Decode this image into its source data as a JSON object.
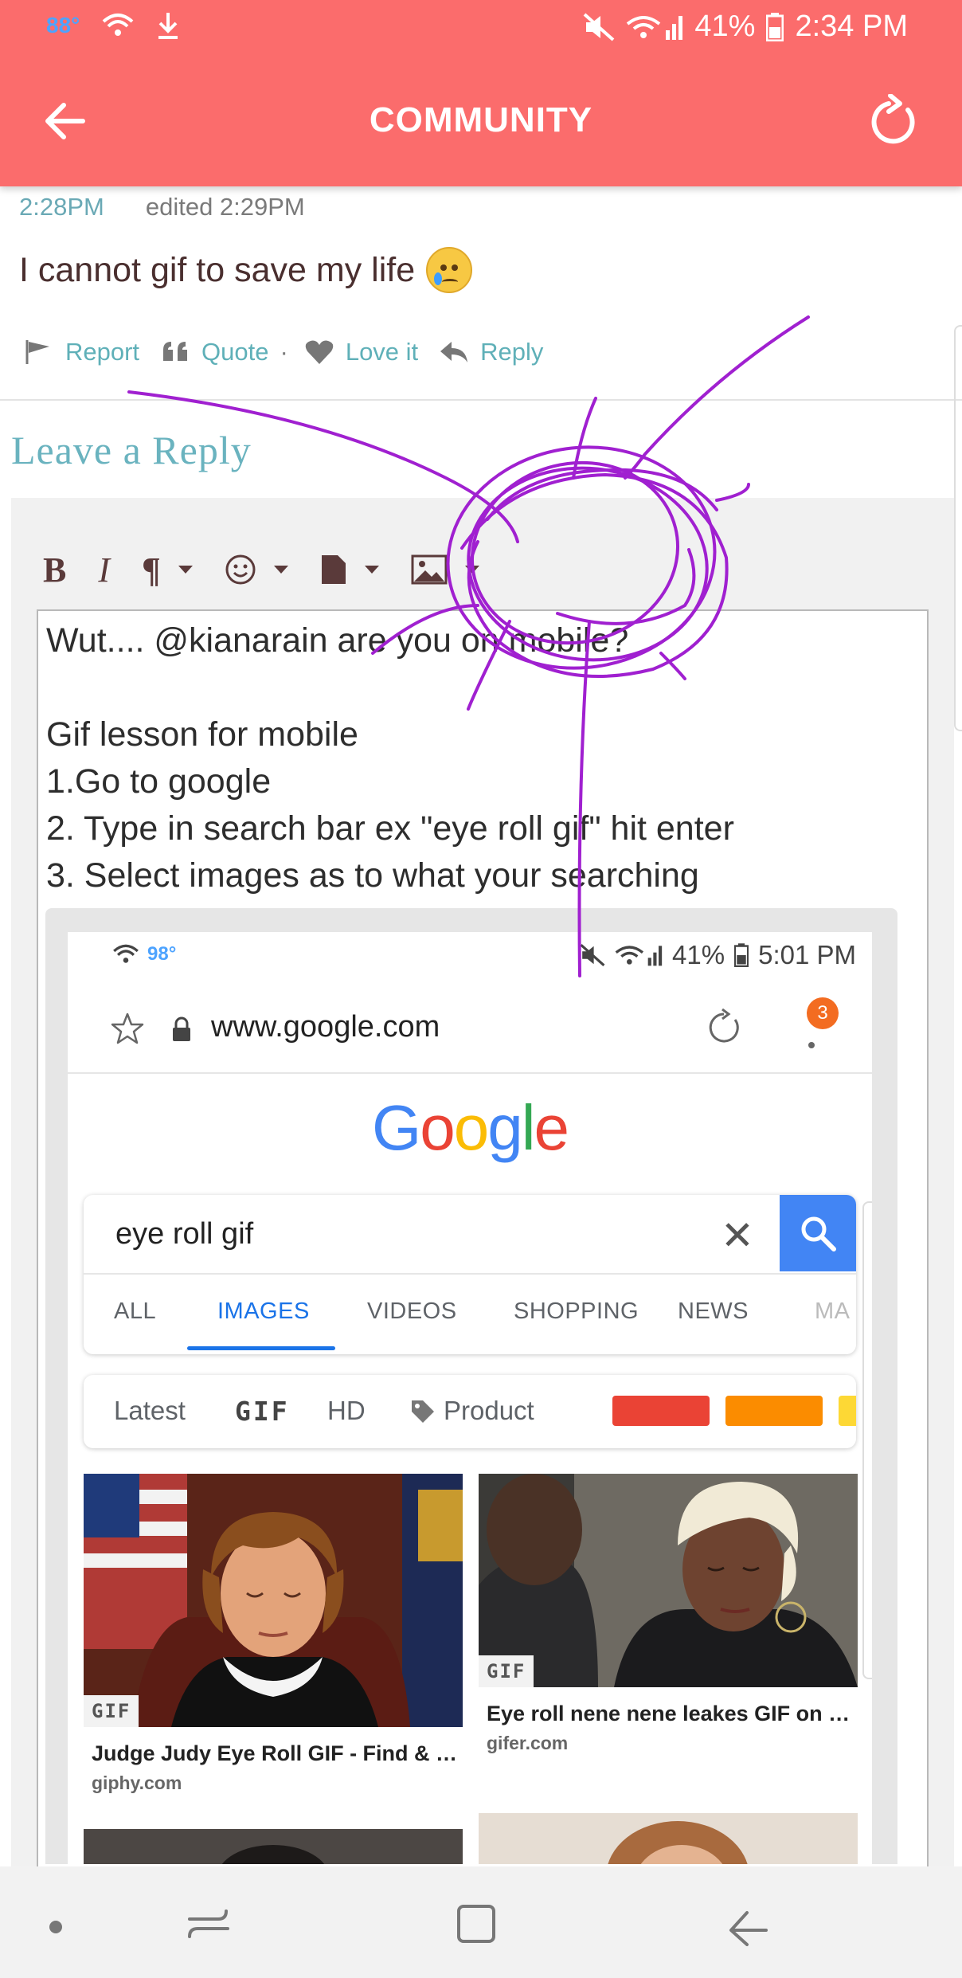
{
  "status_bar": {
    "temperature": "88°",
    "battery": "41%",
    "time": "2:34 PM"
  },
  "app_bar": {
    "title": "COMMUNITY"
  },
  "post": {
    "time": "2:28PM",
    "edited": "edited 2:29PM",
    "body": "I cannot gif to save my life",
    "emoji": "crying-face"
  },
  "post_actions": [
    {
      "label": "Report",
      "icon": "flag-icon"
    },
    {
      "label": "Quote",
      "icon": "quote-icon"
    },
    {
      "label": "Love it",
      "icon": "heart-icon"
    },
    {
      "label": "Reply",
      "icon": "reply-icon"
    }
  ],
  "reply_section": {
    "heading": "Leave a Reply"
  },
  "editor_toolbar": {
    "bold": "B",
    "italic": "I",
    "paragraph": "¶"
  },
  "editor": {
    "lines": [
      "Wut.... @kianarain are you on mobile?",
      "",
      "Gif lesson for mobile",
      "1.Go to google",
      "2. Type in search bar ex \"eye roll gif\" hit enter",
      "3. Select images as to what your searching"
    ]
  },
  "embedded_screenshot": {
    "status": {
      "temperature": "98°",
      "battery": "41%",
      "time": "5:01 PM"
    },
    "url": "www.google.com",
    "badge_count": "3",
    "logo_letters": [
      "G",
      "o",
      "o",
      "g",
      "l",
      "e"
    ],
    "search_query": "eye roll gif",
    "tabs": [
      "ALL",
      "IMAGES",
      "VIDEOS",
      "SHOPPING",
      "NEWS",
      "MA"
    ],
    "active_tab": "IMAGES",
    "filters": {
      "latest": "Latest",
      "gif": "GIF",
      "hd": "HD",
      "product": "Product"
    },
    "color_swatches": [
      "#ea4335",
      "#fb8c00",
      "#fdd835"
    ],
    "results": [
      {
        "title": "Judge Judy Eye Roll GIF - Find & S...",
        "source": "giphy.com",
        "badge": "GIF"
      },
      {
        "title": "Eye roll nene nene leakes GIF on G...",
        "source": "gifer.com",
        "badge": "GIF"
      }
    ]
  },
  "colors": {
    "app_bar": "#fb6c6c",
    "accent_teal": "#6ab3bf",
    "scribble": "#a020d0",
    "google_blue": "#4285f4"
  }
}
